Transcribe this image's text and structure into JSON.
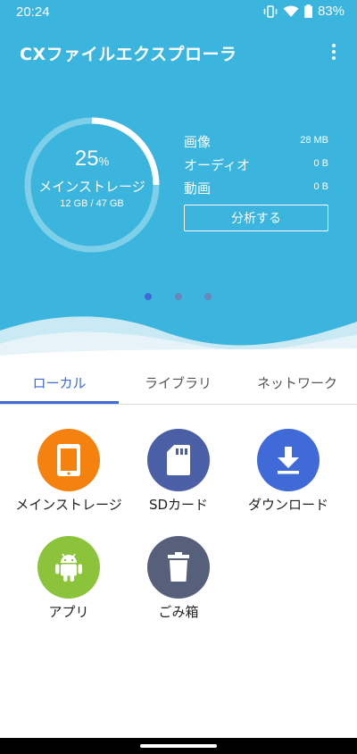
{
  "status_bar": {
    "time": "20:24",
    "battery": "83%"
  },
  "app": {
    "title": "CXファイルエクスプローラ"
  },
  "storage": {
    "percent": "25",
    "percent_unit": "%",
    "percent_value": 25,
    "name": "メインストレージ",
    "size_text": "12 GB / 47 GB"
  },
  "stats": [
    {
      "label": "画像",
      "value": "28 MB"
    },
    {
      "label": "オーディオ",
      "value": "0 B"
    },
    {
      "label": "動画",
      "value": "0 B"
    }
  ],
  "analyze_button": "分析する",
  "pager": {
    "count": 3,
    "active": 0
  },
  "tabs": [
    {
      "label": "ローカル",
      "active": true
    },
    {
      "label": "ライブラリ",
      "active": false
    },
    {
      "label": "ネットワーク",
      "active": false
    }
  ],
  "locations": [
    {
      "label": "メインストレージ",
      "icon": "tablet-icon",
      "color": "#f5820f"
    },
    {
      "label": "SDカード",
      "icon": "sd-card-icon",
      "color": "#4a5fa5"
    },
    {
      "label": "ダウンロード",
      "icon": "download-icon",
      "color": "#3f6ad8"
    },
    {
      "label": "アプリ",
      "icon": "android-icon",
      "color": "#8bc33a"
    },
    {
      "label": "ごみ箱",
      "icon": "trash-icon",
      "color": "#56607a"
    }
  ],
  "colors": {
    "header": "#3bb5dd",
    "accent": "#3f6ad8",
    "highlight_border": "#e2202e",
    "highlight_fill": "#f9c8ca"
  }
}
